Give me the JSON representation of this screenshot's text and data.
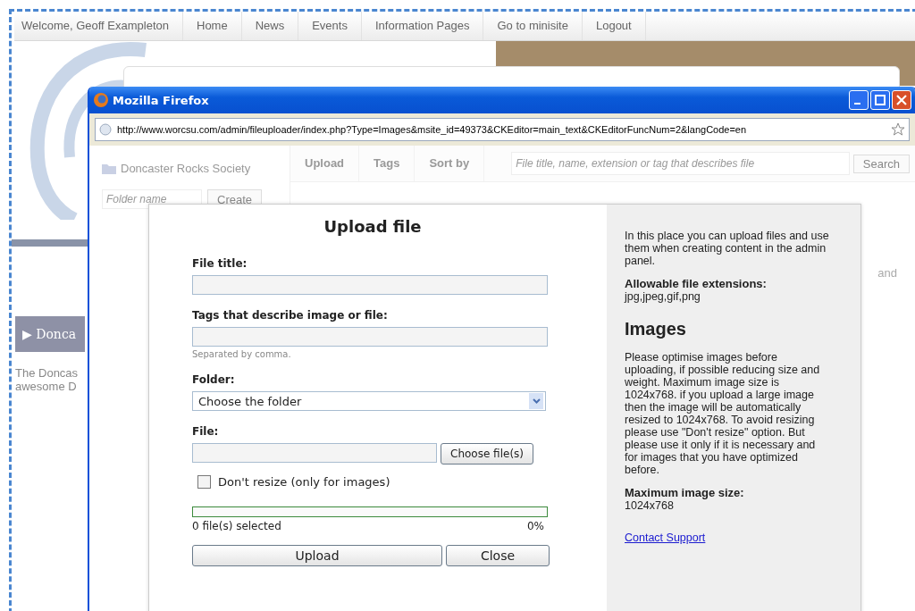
{
  "nav": {
    "welcome": "Welcome, Geoff Exampleton",
    "links": [
      "Home",
      "News",
      "Events",
      "Information Pages",
      "Go to minisite",
      "Logout"
    ]
  },
  "background_page": {
    "section_bar": "▶ Donca",
    "intro_lines": [
      "The Doncas",
      "awesome D"
    ]
  },
  "window": {
    "title": "Mozilla Firefox",
    "url": "http://www.worcsu.com/admin/fileuploader/index.php?Type=Images&msite_id=49373&CKEditor=main_text&CKEditorFuncNum=2&langCode=en"
  },
  "file_manager": {
    "folder": "Doncaster Rocks Society",
    "folder_name_placeholder": "Folder name",
    "create_button": "Create",
    "toolbar": [
      "Upload",
      "Tags",
      "Sort by"
    ],
    "search_placeholder": "File title, name, extension or tag that describes file",
    "search_button": "Search",
    "side_text": "and"
  },
  "upload_dialog": {
    "title": "Upload file",
    "fields": [
      {
        "kind": "text",
        "label": "File title:"
      },
      {
        "kind": "text",
        "label": "Tags that describe image or file:",
        "hint": "Separated by comma."
      },
      {
        "kind": "select",
        "label": "Folder:",
        "value": "Choose the folder"
      },
      {
        "kind": "file",
        "label": "File:",
        "button": "Choose file(s)"
      }
    ],
    "dont_resize": {
      "label": "Don't resize (only for images)",
      "checked": false
    },
    "progress": {
      "level": 0,
      "status": "0 file(s) selected",
      "percent": "0%"
    },
    "buttons": [
      "Upload",
      "Close"
    ]
  },
  "info_panel": {
    "intro": "In this place you can upload files and use them when creating content in the admin panel.",
    "extensions_label": "Allowable file extensions:",
    "extensions": "jpg,jpeg,gif,png",
    "heading": "Images",
    "body": "Please optimise images before uploading, if possible reducing size and weight. Maximum image size is 1024x768. if you upload a large image then the image will be automatically resized to 1024x768. To avoid resizing please use \"Don't resize\" option. But please use it only if it is necessary and for images that you have optimized before.",
    "max_size_label": "Maximum image size:",
    "max_size": "1024x768",
    "link": "Contact Support"
  }
}
